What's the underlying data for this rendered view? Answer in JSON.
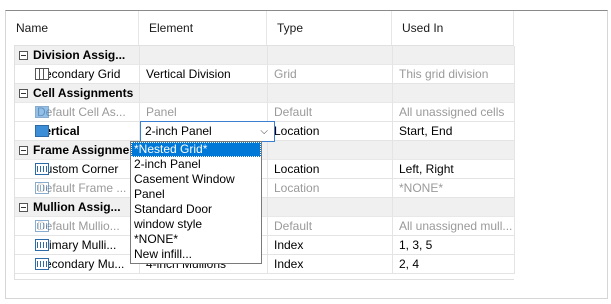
{
  "columns": [
    "Name",
    "Element",
    "Type",
    "Used In"
  ],
  "rows": [
    {
      "kind": "cat",
      "label": "Division Assig..."
    },
    {
      "kind": "item",
      "icon": "grid",
      "name": "Secondary Grid",
      "element": "Vertical Division",
      "type": "Grid",
      "used_in": "This grid division",
      "dim": false
    },
    {
      "kind": "cat",
      "label": "Cell Assignments"
    },
    {
      "kind": "item",
      "icon": "panel",
      "name": "Default Cell As...",
      "element": "Panel",
      "type": "Default",
      "used_in": "All unassigned cells",
      "dim": true
    },
    {
      "kind": "item",
      "icon": "panel",
      "name": "Vertical",
      "element": "2-inch Panel",
      "type": "Location",
      "used_in": "Start, End",
      "dim": false,
      "editing": true
    },
    {
      "kind": "cat",
      "label": "Frame Assignme..."
    },
    {
      "kind": "item",
      "icon": "mullion",
      "name": "Custom Corner",
      "element": "",
      "type": "Location",
      "used_in": "Left, Right",
      "dim": false
    },
    {
      "kind": "item",
      "icon": "mullion",
      "name": "Default Frame ...",
      "element": "",
      "type": "Location",
      "used_in": "*NONE*",
      "dim": true
    },
    {
      "kind": "cat",
      "label": "Mullion Assig..."
    },
    {
      "kind": "item",
      "icon": "mullion",
      "name": "Default Mullio...",
      "element": "",
      "type": "Default",
      "used_in": "All unassigned mull...",
      "dim": true
    },
    {
      "kind": "item",
      "icon": "mullion",
      "name": "Primary Mulli...",
      "element": "",
      "type": "Index",
      "used_in": "1, 3, 5",
      "dim": false
    },
    {
      "kind": "item",
      "icon": "mullion",
      "name": "Secondary Mu...",
      "element": "4-inch Mullions",
      "type": "Index",
      "used_in": "2, 4",
      "dim": false
    }
  ],
  "combo": {
    "value": "2-inch Panel",
    "arrow": "⌵"
  },
  "dropdown": {
    "selected_index": 0,
    "options": [
      "*Nested Grid*",
      "2-inch Panel",
      "Casement Window",
      "Panel",
      "Standard Door",
      "window style",
      "*NONE*",
      "New infill..."
    ]
  },
  "colors": {
    "selection": "#0078d7",
    "category_bg": "#f0f0f0",
    "dim_text": "#9a9a9a"
  }
}
